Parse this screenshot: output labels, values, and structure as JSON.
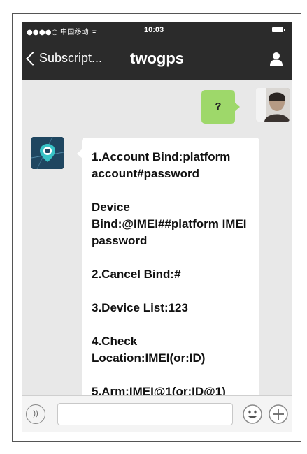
{
  "status_bar": {
    "carrier": "●●●●○ 中国移动 ᯤ",
    "time": "10:03"
  },
  "nav": {
    "back_label": "Subscript...",
    "title": "twogps"
  },
  "chat": {
    "outgoing_message": "?",
    "incoming_message_lines": [
      "1.Account Bind:platform account#password",
      "Device Bind:@IMEI##platform IMEI password",
      "2.Cancel Bind:#",
      "3.Device List:123",
      "4.Check Location:IMEI(or:ID)",
      "5.Arm:IMEI@1(or:ID@1)"
    ]
  },
  "input_bar": {
    "text_value": "",
    "placeholder": ""
  },
  "colors": {
    "top_bar": "#2b2b2b",
    "chat_background": "#e8e8e8",
    "outgoing_bubble": "#9ed86a",
    "incoming_bubble": "#ffffff"
  }
}
